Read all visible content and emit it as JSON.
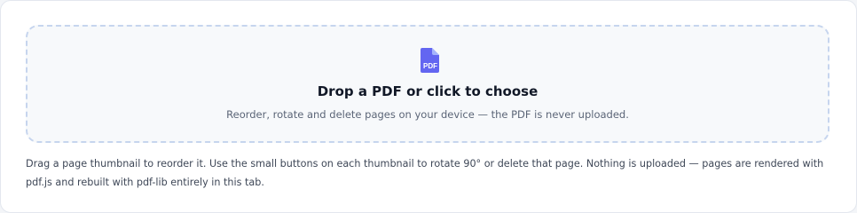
{
  "dropzone": {
    "icon": "pdf-file-icon",
    "icon_label": "PDF",
    "title": "Drop a PDF or click to choose",
    "subtitle": "Reorder, rotate and delete pages on your device — the PDF is never uploaded."
  },
  "help": {
    "text": "Drag a page thumbnail to reorder it. Use the small buttons on each thumbnail to rotate 90° or delete that page. Nothing is uploaded — pages are rendered with pdf.js and rebuilt with pdf-lib entirely in this tab."
  },
  "colors": {
    "accent": "#6366f1",
    "dashed_border": "#c6d5ee",
    "dropzone_bg": "#f7f9fb"
  }
}
